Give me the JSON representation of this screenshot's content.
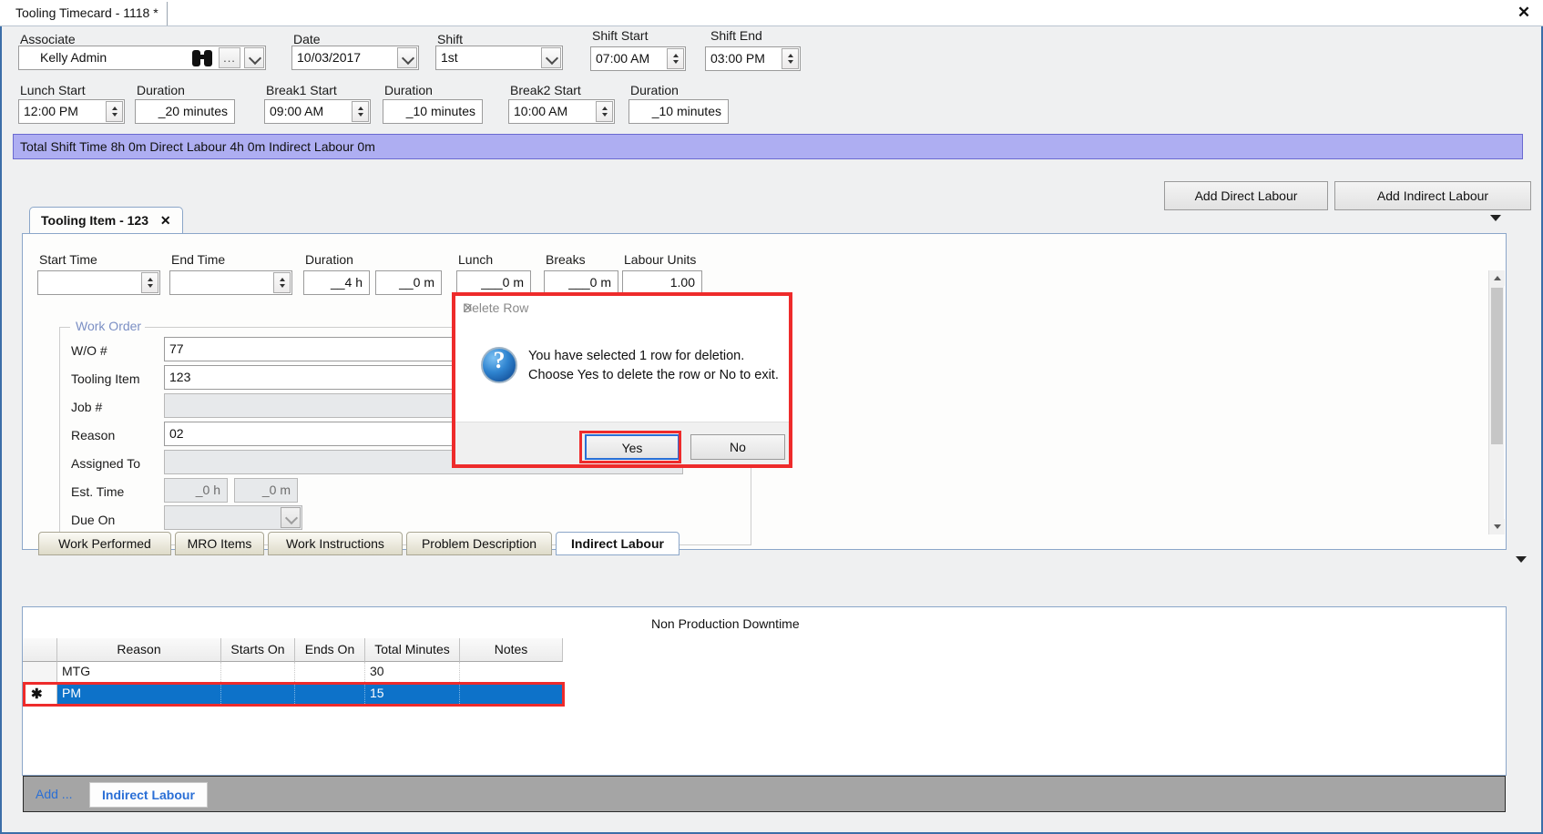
{
  "window": {
    "doc_tab_label": "Tooling Timecard - 1118 *",
    "close_icon": "close-icon"
  },
  "header": {
    "associate": {
      "label": "Associate",
      "value": "Kelly Admin",
      "search_icon": "binoculars-icon",
      "browse_label": "...",
      "dropdown_icon": "chevron-down-icon"
    },
    "date": {
      "label": "Date",
      "value": "10/03/2017"
    },
    "shift": {
      "label": "Shift",
      "value": "1st"
    },
    "shift_start": {
      "label": "Shift Start",
      "value": "07:00 AM"
    },
    "shift_end": {
      "label": "Shift End",
      "value": "03:00 PM"
    },
    "lunch_start": {
      "label": "Lunch Start",
      "value": "12:00 PM"
    },
    "lunch_duration": {
      "label": "Duration",
      "value": "_20 minutes"
    },
    "break1_start": {
      "label": "Break1 Start",
      "value": "09:00 AM"
    },
    "break1_duration": {
      "label": "Duration",
      "value": "_10 minutes"
    },
    "break2_start": {
      "label": "Break2 Start",
      "value": "10:00 AM"
    },
    "break2_duration": {
      "label": "Duration",
      "value": "_10 minutes"
    }
  },
  "banner": {
    "text": "Total Shift Time 8h 0m  Direct Labour 4h 0m  Indirect Labour 0m"
  },
  "toolbar": {
    "add_direct_label": "Add Direct Labour",
    "add_indirect_label": "Add Indirect Labour"
  },
  "item_tab": {
    "label": "Tooling Item - 123",
    "close_icon": "close-icon",
    "caret_icon": "chevron-down-icon"
  },
  "detail": {
    "start_time": {
      "label": "Start Time",
      "value": ""
    },
    "end_time": {
      "label": "End Time",
      "value": ""
    },
    "duration": {
      "label": "Duration",
      "hours": "__4 h",
      "minutes": "__0 m"
    },
    "lunch": {
      "label": "Lunch",
      "value": "___0 m"
    },
    "breaks": {
      "label": "Breaks",
      "value": "___0 m"
    },
    "labour_units": {
      "label": "Labour Units",
      "value": "1.00"
    }
  },
  "work_order": {
    "title": "Work Order",
    "fields": [
      {
        "label": "W/O #",
        "value": "77",
        "readonly": false
      },
      {
        "label": "Tooling Item",
        "value": "123",
        "readonly": false
      },
      {
        "label": "Job #",
        "value": "",
        "readonly": true
      },
      {
        "label": "Reason",
        "value": "02",
        "readonly": false
      },
      {
        "label": "Assigned To",
        "value": "",
        "readonly": true
      }
    ],
    "est_time": {
      "label": "Est. Time",
      "hours": "_0 h",
      "minutes": "_0 m"
    },
    "due_on": {
      "label": "Due On",
      "value": "",
      "dropdown_icon": "chevron-down-icon"
    }
  },
  "bottom_tabs": [
    {
      "label": "Work Performed",
      "selected": false
    },
    {
      "label": "MRO Items",
      "selected": false
    },
    {
      "label": "Work Instructions",
      "selected": false
    },
    {
      "label": "Problem Description",
      "selected": false
    },
    {
      "label": "Indirect Labour",
      "selected": true
    }
  ],
  "grid": {
    "caption": "Non Production Downtime",
    "columns": [
      "Reason",
      "Starts On",
      "Ends On",
      "Total Minutes",
      "Notes"
    ],
    "rows": [
      {
        "indicator": "",
        "Reason": "MTG",
        "Starts On": "",
        "Ends On": "",
        "Total Minutes": "30",
        "Notes": "",
        "selected": false
      },
      {
        "indicator": "new-row-icon",
        "Reason": "PM",
        "Starts On": "",
        "Ends On": "",
        "Total Minutes": "15",
        "Notes": "",
        "selected": true
      }
    ]
  },
  "add_bar": {
    "add_label": "Add ...",
    "button_label": "Indirect Labour"
  },
  "dialog": {
    "title": "Delete Row",
    "close_icon": "close-icon",
    "icon": "question-icon",
    "message_line1": "You have selected 1 row for deletion.",
    "message_line2": "Choose Yes to delete the row or No to exit.",
    "yes_label": "Yes",
    "no_label": "No"
  },
  "colors": {
    "banner_bg": "#aeaef2",
    "selection_blue": "#0d72c9",
    "highlight_red": "#ee2b2b",
    "link_blue": "#2a6fd6",
    "window_border": "#3c6ea8"
  }
}
